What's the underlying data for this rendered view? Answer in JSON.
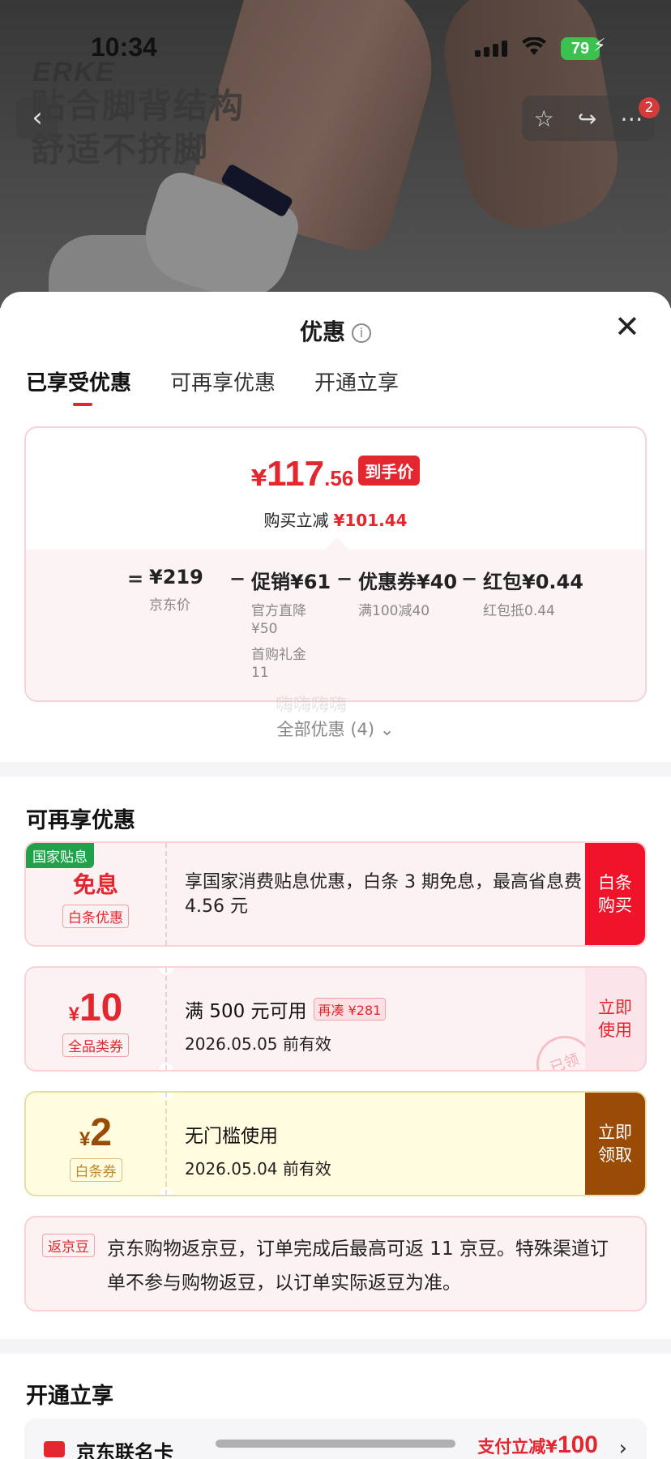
{
  "status_bar": {
    "time": "10:34",
    "battery": "79"
  },
  "hero": {
    "brand": "ERKE",
    "slogan_line1": "贴合脚背结构",
    "slogan_line2": "舒适不挤脚",
    "back_glyph": "‹",
    "cart_badge": "2"
  },
  "sheet": {
    "title": "优惠",
    "info_glyph": "i",
    "close_glyph": "✕",
    "tabs": [
      "已享受优惠",
      "可再享优惠",
      "开通立享"
    ]
  },
  "price_card": {
    "yen": "¥",
    "price_int": "117",
    "price_dec": ".56",
    "price_tag": "到手价",
    "instant_label": "购买立减",
    "instant_amount": "¥101.44",
    "formula": {
      "eq": "=",
      "minus": "−",
      "items": [
        {
          "value": "¥219",
          "desc": [
            "京东价"
          ]
        },
        {
          "value": "促销¥61",
          "desc": [
            "官方直降",
            "¥50",
            "首购礼金",
            "11"
          ]
        },
        {
          "value": "优惠券¥40",
          "desc": [
            "满100减40"
          ]
        },
        {
          "value": "红包¥0.44",
          "desc": [
            "红包抵0.44"
          ]
        }
      ]
    },
    "all_deals": "全部优惠 (4) ⌄",
    "watermark": "嗨嗨嗨嗨"
  },
  "more_section": {
    "title": "可再享优惠",
    "coupons": [
      {
        "corner": "国家贴息",
        "main": "免息",
        "tag": "白条优惠",
        "text": "享国家消费贴息优惠，白条 3 期免息，最高省息费 4.56 元",
        "action": [
          "白条",
          "购买"
        ]
      },
      {
        "yen": "¥",
        "amount": "10",
        "tag": "全品类券",
        "line1": "满 500 元可用",
        "chip": "再凑 ¥281",
        "line2": "2026.05.05 前有效",
        "action": [
          "立即",
          "使用"
        ],
        "stamp": "已领"
      },
      {
        "yen": "¥",
        "amount": "2",
        "tag": "白条券",
        "line1": "无门槛使用",
        "line2": "2026.05.04 前有效",
        "action": [
          "立即",
          "领取"
        ]
      }
    ],
    "jd_bean": {
      "tag": "返京豆",
      "text": "京东购物返京豆，订单完成后最高可返 11 京豆。特殊渠道订单不参与购物返豆，以订单实际返豆为准。"
    }
  },
  "open_section": {
    "title": "开通立享",
    "card_name": "京东联名卡",
    "promo_prefix": "支付立减¥",
    "promo_amount": "100",
    "chevron": "›"
  },
  "colors": {
    "accent": "#e4262e",
    "gov_green": "#1fa24a",
    "gold_brown": "#9a4b05"
  }
}
